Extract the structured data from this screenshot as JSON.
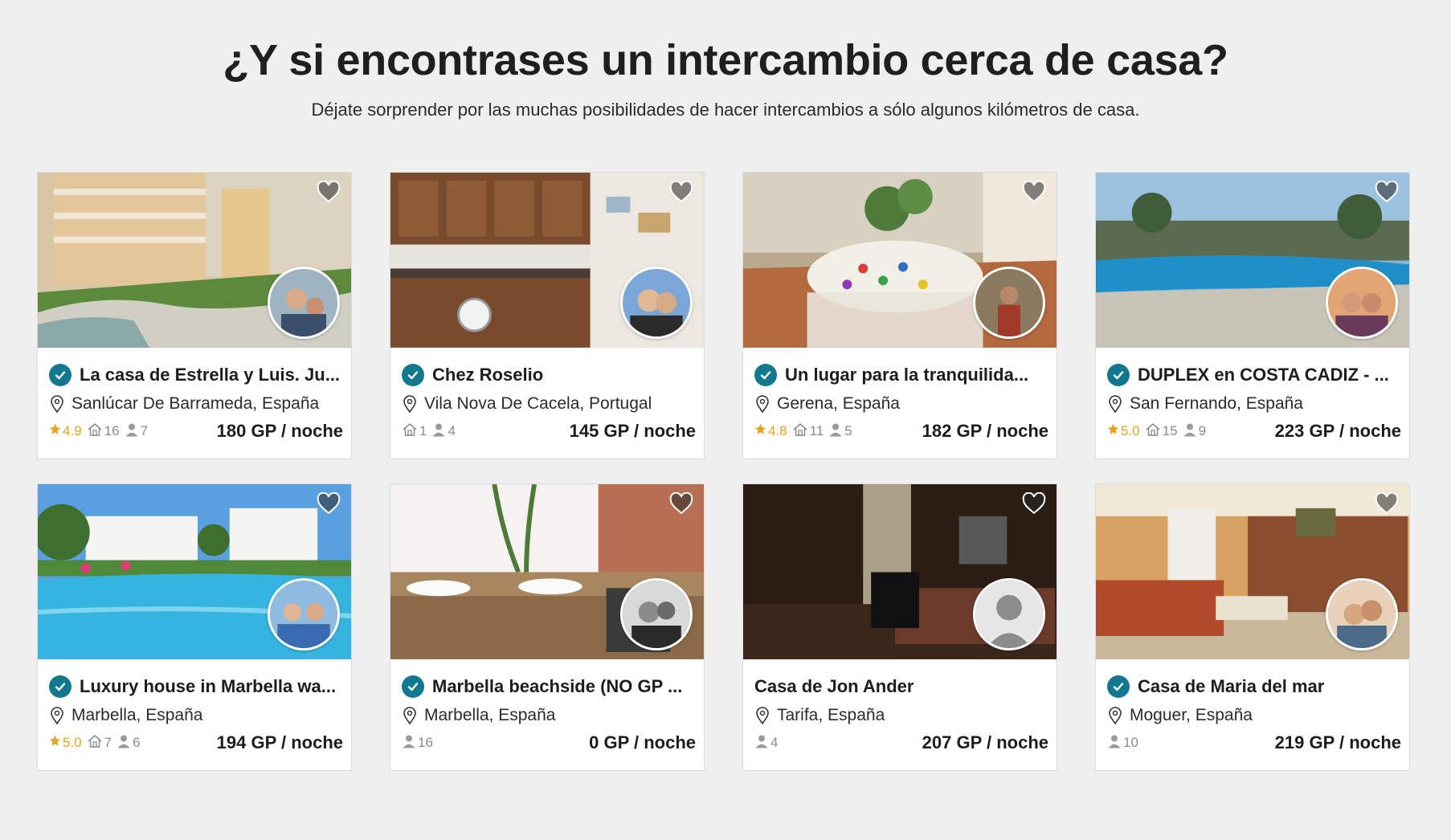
{
  "header": {
    "title": "¿Y si encontrases un intercambio cerca de casa?",
    "subtitle": "Déjate sorprender por las muchas posibilidades de hacer intercambios a sólo algunos kilómetros de casa."
  },
  "colors": {
    "verified": "#11788f",
    "rating_star": "#e6a21f",
    "stat_gray": "#8b8b8b",
    "background": "#efefef"
  },
  "icons": {
    "favorite": "heart-icon",
    "verified": "check-badge-icon",
    "location": "map-pin-icon",
    "rating": "star-icon",
    "rooms": "house-icon",
    "guests": "person-icon"
  },
  "listings": [
    {
      "title": "La casa de Estrella y Luis. Ju...",
      "location": "Sanlúcar De Barrameda, España",
      "rating": "4.9",
      "rooms": "16",
      "guests": "7",
      "price": "180 GP / noche",
      "verified": true
    },
    {
      "title": "Chez Roselio",
      "location": "Vila Nova De Cacela, Portugal",
      "rating": "",
      "rooms": "1",
      "guests": "4",
      "price": "145 GP / noche",
      "verified": true
    },
    {
      "title": "Un lugar para la tranquilida...",
      "location": "Gerena, España",
      "rating": "4.8",
      "rooms": "11",
      "guests": "5",
      "price": "182 GP / noche",
      "verified": true
    },
    {
      "title": "DUPLEX en COSTA CADIZ - ...",
      "location": "San Fernando, España",
      "rating": "5.0",
      "rooms": "15",
      "guests": "9",
      "price": "223 GP / noche",
      "verified": true
    },
    {
      "title": "Luxury house in Marbella wa...",
      "location": "Marbella, España",
      "rating": "5.0",
      "rooms": "7",
      "guests": "6",
      "price": "194 GP / noche",
      "verified": true
    },
    {
      "title": "Marbella beachside (NO GP ...",
      "location": "Marbella, España",
      "rating": "",
      "rooms": "",
      "guests": "16",
      "price": "0 GP / noche",
      "verified": true
    },
    {
      "title": "Casa de Jon Ander",
      "location": "Tarifa, España",
      "rating": "",
      "rooms": "",
      "guests": "4",
      "price": "207 GP / noche",
      "verified": false
    },
    {
      "title": "Casa de Maria del mar",
      "location": "Moguer, España",
      "rating": "",
      "rooms": "",
      "guests": "10",
      "price": "219 GP / noche",
      "verified": true
    }
  ]
}
